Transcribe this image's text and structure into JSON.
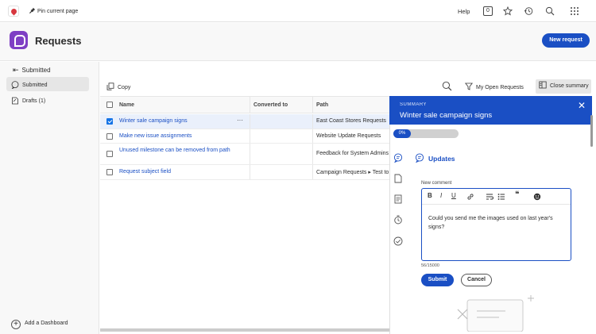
{
  "topbar": {
    "pin_label": "Pin current page",
    "help_label": "Help",
    "shortcut_key": "0"
  },
  "header": {
    "title": "Requests",
    "new_button": "New request"
  },
  "sidebar": {
    "back_label": "Submitted",
    "items": [
      {
        "label": "Submitted"
      },
      {
        "label": "Drafts (1)"
      }
    ],
    "add_dashboard": "Add a Dashboard"
  },
  "toolbar": {
    "copy_label": "Copy",
    "filter_label": "My Open Requests",
    "close_summary_label": "Close summary"
  },
  "table": {
    "columns": [
      "Name",
      "Converted to",
      "Path"
    ],
    "rows": [
      {
        "name": "Winter sale campaign signs",
        "converted": "",
        "path": "East Coast Stores Requests",
        "selected": true,
        "more": "···"
      },
      {
        "name": "Make new issue assignments",
        "converted": "",
        "path": "Website Update Requests",
        "selected": false
      },
      {
        "name": "Unused milestone can be removed from path",
        "converted": "",
        "path": "Feedback for System Admins",
        "selected": false
      },
      {
        "name": "Request subject field",
        "converted": "",
        "path": "Campaign Requests ▸ Test to",
        "selected": false
      }
    ]
  },
  "summary": {
    "label": "SUMMARY",
    "title": "Winter sale campaign signs",
    "progress": "0%",
    "progress_value": 0,
    "updates_label": "Updates",
    "new_comment_label": "New comment",
    "comment_text": "Could you send me the images used on last year's signs?",
    "char_count": "56/15000",
    "submit_label": "Submit",
    "cancel_label": "Cancel",
    "toolbar_glyphs": {
      "bold": "B",
      "italic": "I",
      "underline": "U",
      "quote": "❝"
    }
  },
  "colors": {
    "accent": "#1a4fc4",
    "app_icon": "#7e3fc4",
    "logo": "#d7373f"
  }
}
